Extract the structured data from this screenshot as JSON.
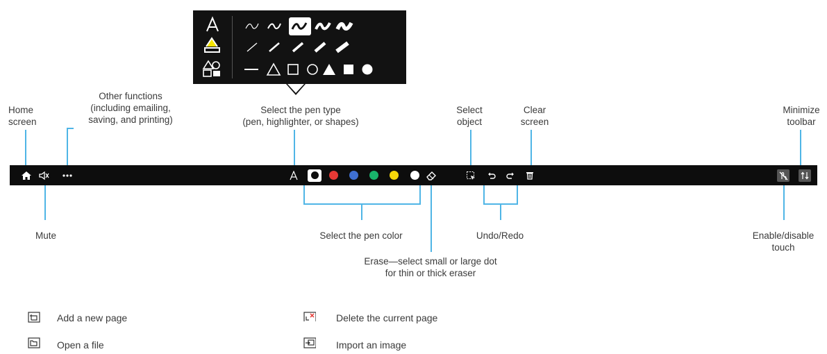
{
  "labels": {
    "home_screen": [
      "Home",
      "screen"
    ],
    "other_functions": [
      "Other functions",
      "(including emailing,",
      "saving, and printing)"
    ],
    "pen_type": [
      "Select the pen type",
      "(pen, highlighter, or shapes)"
    ],
    "select_object": [
      "Select",
      "object"
    ],
    "clear_screen": [
      "Clear",
      "screen"
    ],
    "minimize_toolbar": [
      "Minimize",
      "toolbar"
    ],
    "mute": "Mute",
    "pen_color": "Select the pen color",
    "undo_redo": "Undo/Redo",
    "touch": [
      "Enable/disable",
      "touch"
    ],
    "erase": [
      "Erase—select small or large dot",
      "for thin or thick eraser"
    ]
  },
  "legend": [
    {
      "icon": "add-page-icon",
      "text": "Add a new page"
    },
    {
      "icon": "delete-page-icon",
      "text": "Delete the current page"
    },
    {
      "icon": "open-file-icon",
      "text": "Open a file"
    },
    {
      "icon": "import-image-icon",
      "text": "Import an image"
    }
  ],
  "pen_colors": [
    "#ffffff",
    "#e53935",
    "#3f6fd1",
    "#19b36b",
    "#f5d60a",
    "#ffffff"
  ],
  "colors": {
    "toolbar": "#0d0d0d",
    "popup": "#121212",
    "callout": "#4fb5e6",
    "highlight_yellow": "#f5e400"
  },
  "toolbar_icons": [
    "home-icon",
    "mute-icon",
    "more-icon",
    "pen-type-icon",
    "eraser-icon",
    "select-object-icon",
    "undo-icon",
    "redo-icon",
    "clear-screen-icon",
    "touch-toggle-icon",
    "minimize-toolbar-icon"
  ],
  "popup_icons": [
    "pen-icon",
    "highlighter-icon",
    "shapes-icon",
    "stroke-style-icons",
    "line-width-icons",
    "shape-icons"
  ]
}
